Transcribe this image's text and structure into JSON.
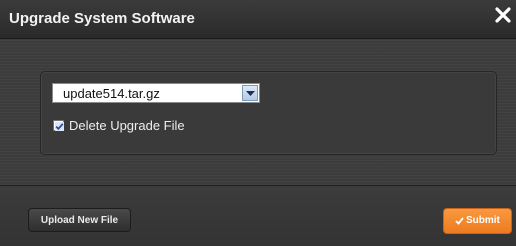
{
  "dialog": {
    "title": "Upgrade System Software",
    "close_glyph": "✕"
  },
  "form": {
    "file_select": {
      "value": "update514.tar.gz",
      "options": [
        "update514.tar.gz"
      ]
    },
    "delete_checkbox": {
      "label": "Delete Upgrade File",
      "checked": true
    }
  },
  "footer": {
    "upload_label": "Upload New File",
    "submit_label": "Submit",
    "submit_icon": "checkmark-icon"
  },
  "colors": {
    "titlebar": "#2e2e2e",
    "body": "#3e3e3e",
    "submit_accent": "#f58a2e",
    "checkbox_mark": "#2b4f9e"
  }
}
